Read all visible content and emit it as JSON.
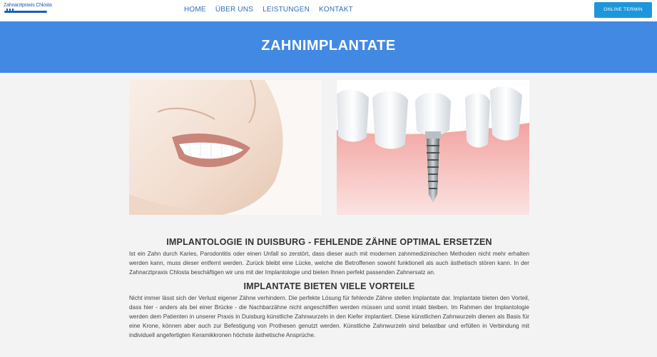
{
  "header": {
    "logo_text": "Zahnarztpraxis Chlosta",
    "nav": [
      "HOME",
      "ÜBER UNS",
      "LEISTUNGEN",
      "KONTAKT"
    ],
    "cta_label": "ONLINE TERMIN"
  },
  "hero": {
    "title": "ZAHNIMPLANTATE"
  },
  "images": {
    "left": "smile-photo",
    "right": "dental-implant-illustration"
  },
  "content": {
    "heading1": "IMPLANTOLOGIE IN DUISBURG - FEHLENDE ZÄHNE OPTIMAL ERSETZEN",
    "paragraph1": "Ist ein Zahn durch Karies, Parodontitis oder einen Unfall so zerstört, dass dieser auch mit modernen zahnmedizinischen Methoden nicht mehr erhalten werden kann, muss dieser entfernt werden. Zurück bleibt eine Lücke, welche die Betroffenen sowohl funktionell als auch ästhetisch stören kann. In der Zahnarztpraxis Chlosta beschäftigen wir uns mit der Implantologie und bieten Ihnen perfekt passenden Zahnersatz an.",
    "heading2": "IMPLANTATE BIETEN VIELE VORTEILE",
    "paragraph2": "Nicht immer lässt sich der Verlust eigener Zähne verhindern. Die perfekte Lösung für fehlende Zähne stellen Implantate dar. Implantate bieten den Vorteil, dass hier - anders als bei einer Brücke - die Nachbarzähne nicht angeschliffen werden müssen und somit intakt bleiben. Im Rahmen der Implantologie werden dem Patienten in unserer Praxis in Duisburg künstliche Zahnwurzeln in den Kiefer implantiert. Diese künstlichen Zahnwurzeln dienen als Basis für eine Krone, können aber auch zur Befestigung von Prothesen genutzt werden. Künstliche Zahnwurzeln sind belastbar und erfüllen in Verbindung mit individuell angefertigten Keramikkronen höchste ästhetische Ansprüche."
  },
  "colors": {
    "hero_bg": "#4189e3",
    "cta_bg": "#1e96dc",
    "nav_link": "#2f6fb7"
  }
}
